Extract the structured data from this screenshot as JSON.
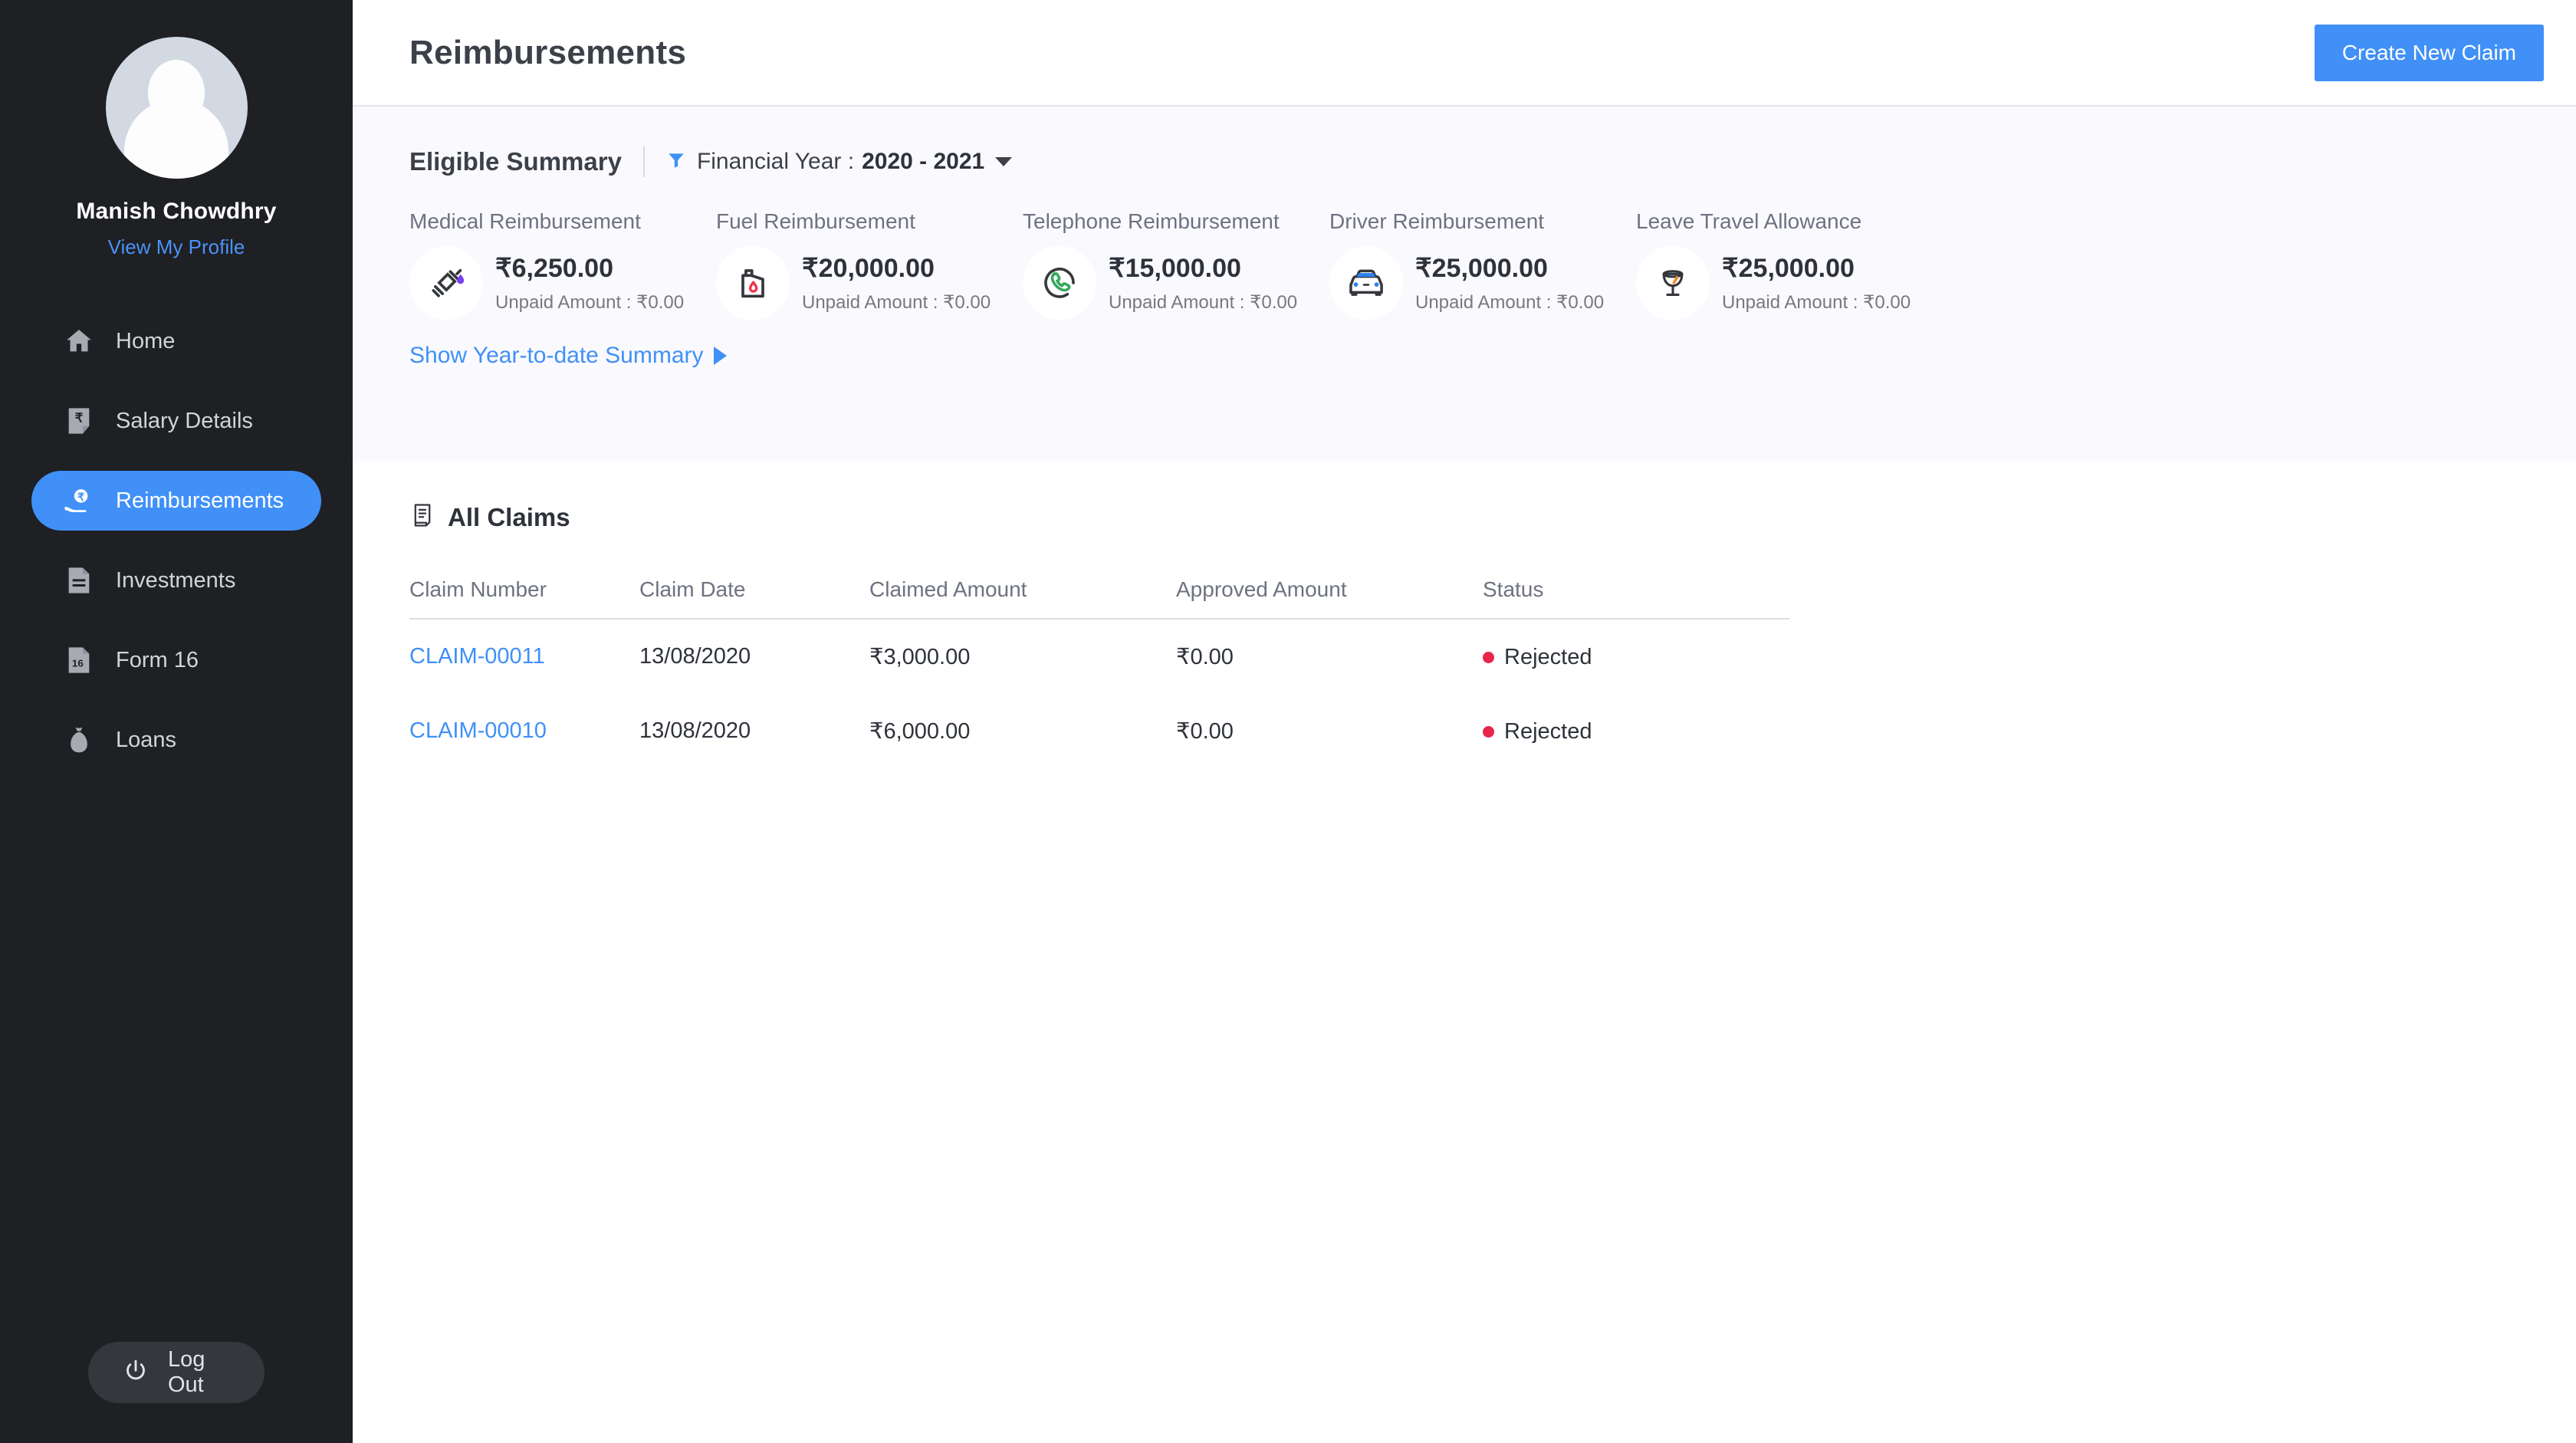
{
  "sidebar": {
    "user_name": "Manish Chowdhry",
    "profile_link": "View My Profile",
    "items": [
      {
        "label": "Home",
        "icon": "home-icon",
        "active": false
      },
      {
        "label": "Salary Details",
        "icon": "salary-document-icon",
        "active": false
      },
      {
        "label": "Reimbursements",
        "icon": "hand-rupee-icon",
        "active": true
      },
      {
        "label": "Investments",
        "icon": "document-lines-icon",
        "active": false
      },
      {
        "label": "Form 16",
        "icon": "form-16-document-icon",
        "active": false
      },
      {
        "label": "Loans",
        "icon": "money-bag-icon",
        "active": false
      }
    ],
    "logout_label": "Log Out",
    "logout_icon": "power-icon"
  },
  "header": {
    "title": "Reimbursements",
    "create_button": "Create New Claim"
  },
  "summary": {
    "title": "Eligible Summary",
    "filter_icon": "funnel-filter-icon",
    "financial_year_label": "Financial Year :",
    "financial_year_value": "2020 - 2021",
    "cards": [
      {
        "label": "Medical Reimbursement",
        "amount": "₹6,250.00",
        "unpaid": "Unpaid Amount : ₹0.00",
        "icon": "syringe-icon"
      },
      {
        "label": "Fuel Reimbursement",
        "amount": "₹20,000.00",
        "unpaid": "Unpaid Amount : ₹0.00",
        "icon": "fuel-can-icon"
      },
      {
        "label": "Telephone Reimbursement",
        "amount": "₹15,000.00",
        "unpaid": "Unpaid Amount : ₹0.00",
        "icon": "phone-icon"
      },
      {
        "label": "Driver Reimbursement",
        "amount": "₹25,000.00",
        "unpaid": "Unpaid Amount : ₹0.00",
        "icon": "car-icon"
      },
      {
        "label": "Leave Travel Allowance",
        "amount": "₹25,000.00",
        "unpaid": "Unpaid Amount : ₹0.00",
        "icon": "cocktail-glass-icon"
      }
    ],
    "ytd_link": "Show Year-to-date Summary"
  },
  "claims": {
    "title": "All Claims",
    "icon": "claims-document-icon",
    "columns": [
      "Claim Number",
      "Claim Date",
      "Claimed Amount",
      "Approved Amount",
      "Status"
    ],
    "rows": [
      {
        "number": "CLAIM-00011",
        "date": "13/08/2020",
        "claimed": "₹3,000.00",
        "approved": "₹0.00",
        "status": "Rejected"
      },
      {
        "number": "CLAIM-00010",
        "date": "13/08/2020",
        "claimed": "₹6,000.00",
        "approved": "₹0.00",
        "status": "Rejected"
      }
    ]
  },
  "colors": {
    "accent": "#4090F7",
    "sidebar_bg": "#1E2024",
    "summary_bg": "#FAFAFE",
    "status_rejected": "#E8264B",
    "text_dark": "#2E323A",
    "text_muted": "#6E7280"
  }
}
